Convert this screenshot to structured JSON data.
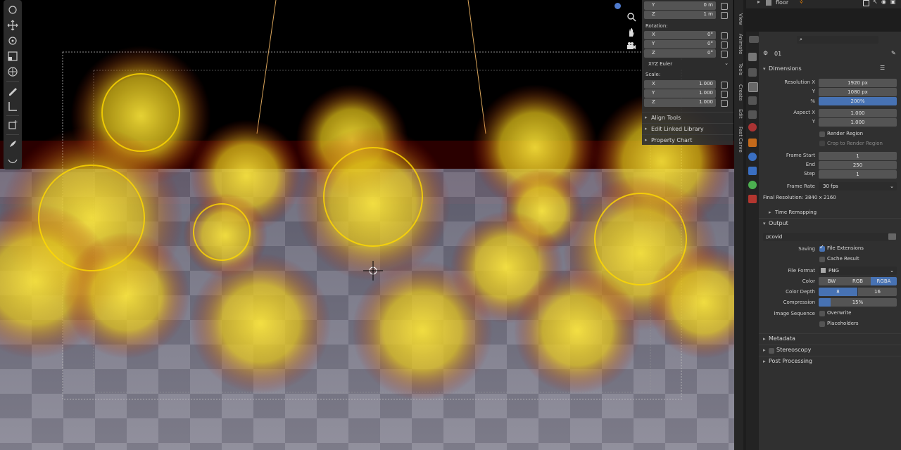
{
  "n_panel": {
    "location_y": {
      "axis": "Y",
      "value": "0 m"
    },
    "location_z": {
      "axis": "Z",
      "value": "1 m"
    },
    "rotation_label": "Rotation:",
    "rotation": [
      {
        "axis": "X",
        "value": "0°"
      },
      {
        "axis": "Y",
        "value": "0°"
      },
      {
        "axis": "Z",
        "value": "0°"
      }
    ],
    "rotation_mode": "XYZ Euler",
    "scale_label": "Scale:",
    "scale": [
      {
        "axis": "X",
        "value": "1.000"
      },
      {
        "axis": "Y",
        "value": "1.000"
      },
      {
        "axis": "Z",
        "value": "1.000"
      }
    ],
    "subpanels": [
      "Align Tools",
      "Edit Linked Library",
      "Property Chart"
    ]
  },
  "side_tabs": [
    "View",
    "Animate",
    "Tools",
    "Create",
    "Edit",
    "Fast Carve"
  ],
  "outliner": {
    "item": "floor"
  },
  "properties": {
    "search_placeholder": "",
    "scene_name": "01",
    "dimensions": {
      "title": "Dimensions",
      "resolution_x_label": "Resolution X",
      "resolution_x": "1920 px",
      "resolution_y_label": "Y",
      "resolution_y": "1080 px",
      "percent_label": "%",
      "percent": "200%",
      "percent_value": 200,
      "aspect_x_label": "Aspect X",
      "aspect_x": "1.000",
      "aspect_y_label": "Y",
      "aspect_y": "1.000",
      "render_region": "Render Region",
      "crop_region": "Crop to Render Region",
      "frame_start_label": "Frame Start",
      "frame_start": "1",
      "end_label": "End",
      "end": "250",
      "step_label": "Step",
      "step": "1",
      "frame_rate_label": "Frame Rate",
      "frame_rate": "30 fps",
      "final_resolution": "Final Resolution: 3840 x 2160",
      "time_remapping": "Time Remapping"
    },
    "output": {
      "title": "Output",
      "path": "//covid",
      "saving_label": "Saving",
      "file_extensions": "File Extensions",
      "cache_result": "Cache Result",
      "file_format_label": "File Format",
      "file_format": "PNG",
      "color_label": "Color",
      "color_options": [
        "BW",
        "RGB",
        "RGBA"
      ],
      "color_selected": "RGBA",
      "color_depth_label": "Color Depth",
      "color_depth_options": [
        "8",
        "16"
      ],
      "color_depth_selected": "8",
      "compression_label": "Compression",
      "compression": "15%",
      "compression_value": 15,
      "image_sequence_label": "Image Sequence",
      "overwrite": "Overwrite",
      "placeholders": "Placeholders"
    },
    "collapsed_sections": [
      "Metadata",
      "Stereoscopy",
      "Post Processing"
    ]
  },
  "colors": {
    "accent": "#4772b3",
    "selection": "#ff8a00",
    "virus": "#f5e12a"
  }
}
